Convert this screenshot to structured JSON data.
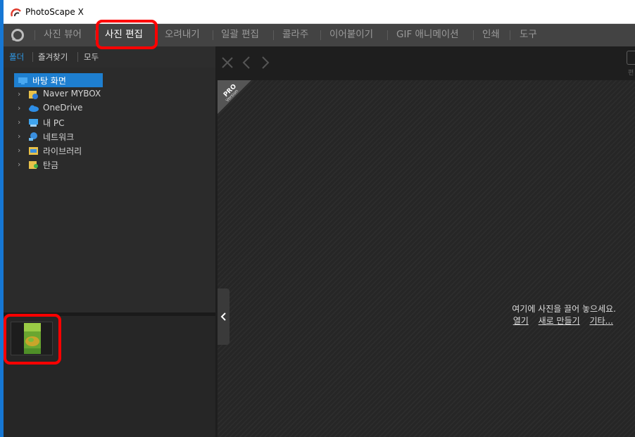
{
  "window": {
    "title": "PhotoScape X"
  },
  "tabs": [
    {
      "label": "사진 뷰어",
      "active": false
    },
    {
      "label": "사진 편집",
      "active": true
    },
    {
      "label": "오려내기",
      "active": false
    },
    {
      "label": "일괄 편집",
      "active": false
    },
    {
      "label": "콜라주",
      "active": false
    },
    {
      "label": "이어붙이기",
      "active": false
    },
    {
      "label": "GIF 애니메이션",
      "active": false
    },
    {
      "label": "인쇄",
      "active": false
    },
    {
      "label": "도구",
      "active": false
    }
  ],
  "subtabs": [
    {
      "label": "폴더",
      "active": true
    },
    {
      "label": "즐겨찾기",
      "active": false
    },
    {
      "label": "모두",
      "active": false
    }
  ],
  "tree": [
    {
      "label": "바탕 화면",
      "icon": "desktop-icon",
      "selected": true
    },
    {
      "label": "Naver MYBOX",
      "icon": "mybox-folder-icon",
      "selected": false
    },
    {
      "label": "OneDrive",
      "icon": "onedrive-cloud-icon",
      "selected": false
    },
    {
      "label": "내 PC",
      "icon": "pc-icon",
      "selected": false
    },
    {
      "label": "네트워크",
      "icon": "network-icon",
      "selected": false
    },
    {
      "label": "라이브러리",
      "icon": "library-icon",
      "selected": false
    },
    {
      "label": "탄금",
      "icon": "user-folder-icon",
      "selected": false
    }
  ],
  "ribbon": {
    "pro": "PRO",
    "version": "Version"
  },
  "canvas": {
    "drop_hint": "여기에 사진을 끌어 놓으세요.",
    "open_link": "열기",
    "new_link": "새로 만들기",
    "other_link": "기타..."
  },
  "toolbar": {
    "edit_label": "편"
  },
  "colors": {
    "accent": "#1e7fd0",
    "highlight": "#ff0000",
    "tab_active": "#ffffff",
    "subtab_active": "#2f9bea"
  }
}
